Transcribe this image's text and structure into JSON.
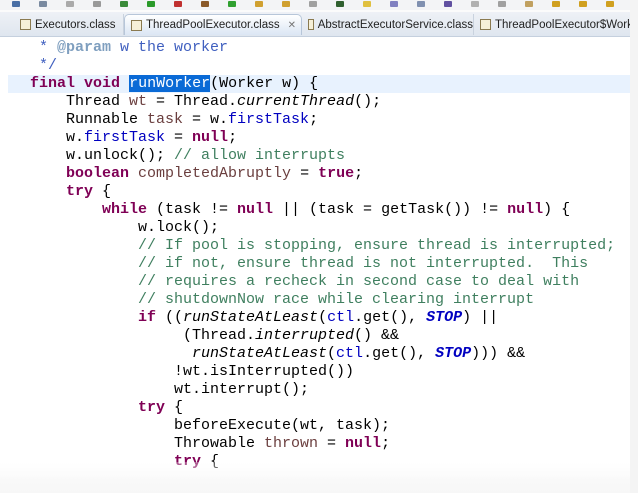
{
  "colors": {
    "keyword": "#7f0055",
    "comment": "#3f7f5f",
    "javadoc": "#3f5fbf",
    "field": "#0000c0",
    "local_variable": "#6a3e3e",
    "selection": "#0a6ad6",
    "current_line": "#e8f2fe"
  },
  "tabs": [
    {
      "label": "Executors.class",
      "icon": "class-file-icon",
      "active": false
    },
    {
      "label": "ThreadPoolExecutor.class",
      "icon": "class-file-icon",
      "active": true,
      "close": "✕"
    },
    {
      "label": "AbstractExecutorService.class",
      "icon": "class-file-icon",
      "active": false
    },
    {
      "label": "ThreadPoolExecutor$Work",
      "icon": "class-file-icon",
      "active": false
    }
  ],
  "editor": {
    "lines": [
      {
        "indent": 0,
        "tokens": [
          {
            "t": " * ",
            "c": "jd"
          },
          {
            "t": "@param",
            "c": "jt"
          },
          {
            "t": " w the worker",
            "c": "jd"
          }
        ]
      },
      {
        "indent": 0,
        "tokens": [
          {
            "t": " */",
            "c": "jd"
          }
        ]
      },
      {
        "indent": 0,
        "current": true,
        "tokens": [
          {
            "t": "final",
            "c": "kw"
          },
          {
            "t": " "
          },
          {
            "t": "void",
            "c": "kw"
          },
          {
            "t": " "
          },
          {
            "t": "runWorker",
            "c": "sel"
          },
          {
            "t": "(Worker w) {"
          }
        ]
      },
      {
        "indent": 4,
        "tokens": [
          {
            "t": "Thread "
          },
          {
            "t": "wt",
            "c": "lv"
          },
          {
            "t": " = Thread."
          },
          {
            "t": "currentThread",
            "c": "it"
          },
          {
            "t": "();"
          }
        ]
      },
      {
        "indent": 4,
        "tokens": [
          {
            "t": "Runnable "
          },
          {
            "t": "task",
            "c": "lv"
          },
          {
            "t": " = w."
          },
          {
            "t": "firstTask",
            "c": "fd"
          },
          {
            "t": ";"
          }
        ]
      },
      {
        "indent": 4,
        "tokens": [
          {
            "t": "w."
          },
          {
            "t": "firstTask",
            "c": "fd"
          },
          {
            "t": " = "
          },
          {
            "t": "null",
            "c": "kw"
          },
          {
            "t": ";"
          }
        ]
      },
      {
        "indent": 4,
        "tokens": [
          {
            "t": "w.unlock(); "
          },
          {
            "t": "// allow interrupts",
            "c": "cm"
          }
        ]
      },
      {
        "indent": 4,
        "tokens": [
          {
            "t": "boolean",
            "c": "kw"
          },
          {
            "t": " "
          },
          {
            "t": "completedAbruptly",
            "c": "lv"
          },
          {
            "t": " = "
          },
          {
            "t": "true",
            "c": "kw"
          },
          {
            "t": ";"
          }
        ]
      },
      {
        "indent": 4,
        "tokens": [
          {
            "t": "try",
            "c": "kw"
          },
          {
            "t": " {"
          }
        ]
      },
      {
        "indent": 8,
        "tokens": [
          {
            "t": "while",
            "c": "kw"
          },
          {
            "t": " (task != "
          },
          {
            "t": "null",
            "c": "kw"
          },
          {
            "t": " || (task = getTask()) != "
          },
          {
            "t": "null",
            "c": "kw"
          },
          {
            "t": ") {"
          }
        ]
      },
      {
        "indent": 12,
        "tokens": [
          {
            "t": "w.lock();"
          }
        ]
      },
      {
        "indent": 12,
        "tokens": [
          {
            "t": "// If pool is stopping, ensure thread is interrupted;",
            "c": "cm"
          }
        ]
      },
      {
        "indent": 12,
        "tokens": [
          {
            "t": "// if not, ensure thread is not interrupted.  This",
            "c": "cm"
          }
        ]
      },
      {
        "indent": 12,
        "tokens": [
          {
            "t": "// requires a recheck in second case to deal with",
            "c": "cm"
          }
        ]
      },
      {
        "indent": 12,
        "tokens": [
          {
            "t": "// shutdownNow race while clearing interrupt",
            "c": "cm"
          }
        ]
      },
      {
        "indent": 12,
        "tokens": [
          {
            "t": "if",
            "c": "kw"
          },
          {
            "t": " (("
          },
          {
            "t": "runStateAtLeast",
            "c": "it"
          },
          {
            "t": "("
          },
          {
            "t": "ctl",
            "c": "fd"
          },
          {
            "t": ".get(), "
          },
          {
            "t": "STOP",
            "c": "st"
          },
          {
            "t": ") ||"
          }
        ]
      },
      {
        "indent": 17,
        "tokens": [
          {
            "t": "(Thread."
          },
          {
            "t": "interrupted",
            "c": "it"
          },
          {
            "t": "() &&"
          }
        ]
      },
      {
        "indent": 18,
        "tokens": [
          {
            "t": "runStateAtLeast",
            "c": "it"
          },
          {
            "t": "("
          },
          {
            "t": "ctl",
            "c": "fd"
          },
          {
            "t": ".get(), "
          },
          {
            "t": "STOP",
            "c": "st"
          },
          {
            "t": "))) &&"
          }
        ]
      },
      {
        "indent": 16,
        "tokens": [
          {
            "t": "!wt.isInterrupted())"
          }
        ]
      },
      {
        "indent": 16,
        "tokens": [
          {
            "t": "wt.interrupt();"
          }
        ]
      },
      {
        "indent": 12,
        "tokens": [
          {
            "t": "try",
            "c": "kw"
          },
          {
            "t": " {"
          }
        ]
      },
      {
        "indent": 16,
        "tokens": [
          {
            "t": "beforeExecute(wt, task);"
          }
        ]
      },
      {
        "indent": 16,
        "tokens": [
          {
            "t": "Throwable "
          },
          {
            "t": "thrown",
            "c": "lv"
          },
          {
            "t": " = "
          },
          {
            "t": "null",
            "c": "kw"
          },
          {
            "t": ";"
          }
        ]
      },
      {
        "indent": 16,
        "tokens": [
          {
            "t": "try",
            "c": "kw"
          },
          {
            "t": " {"
          }
        ]
      }
    ]
  }
}
